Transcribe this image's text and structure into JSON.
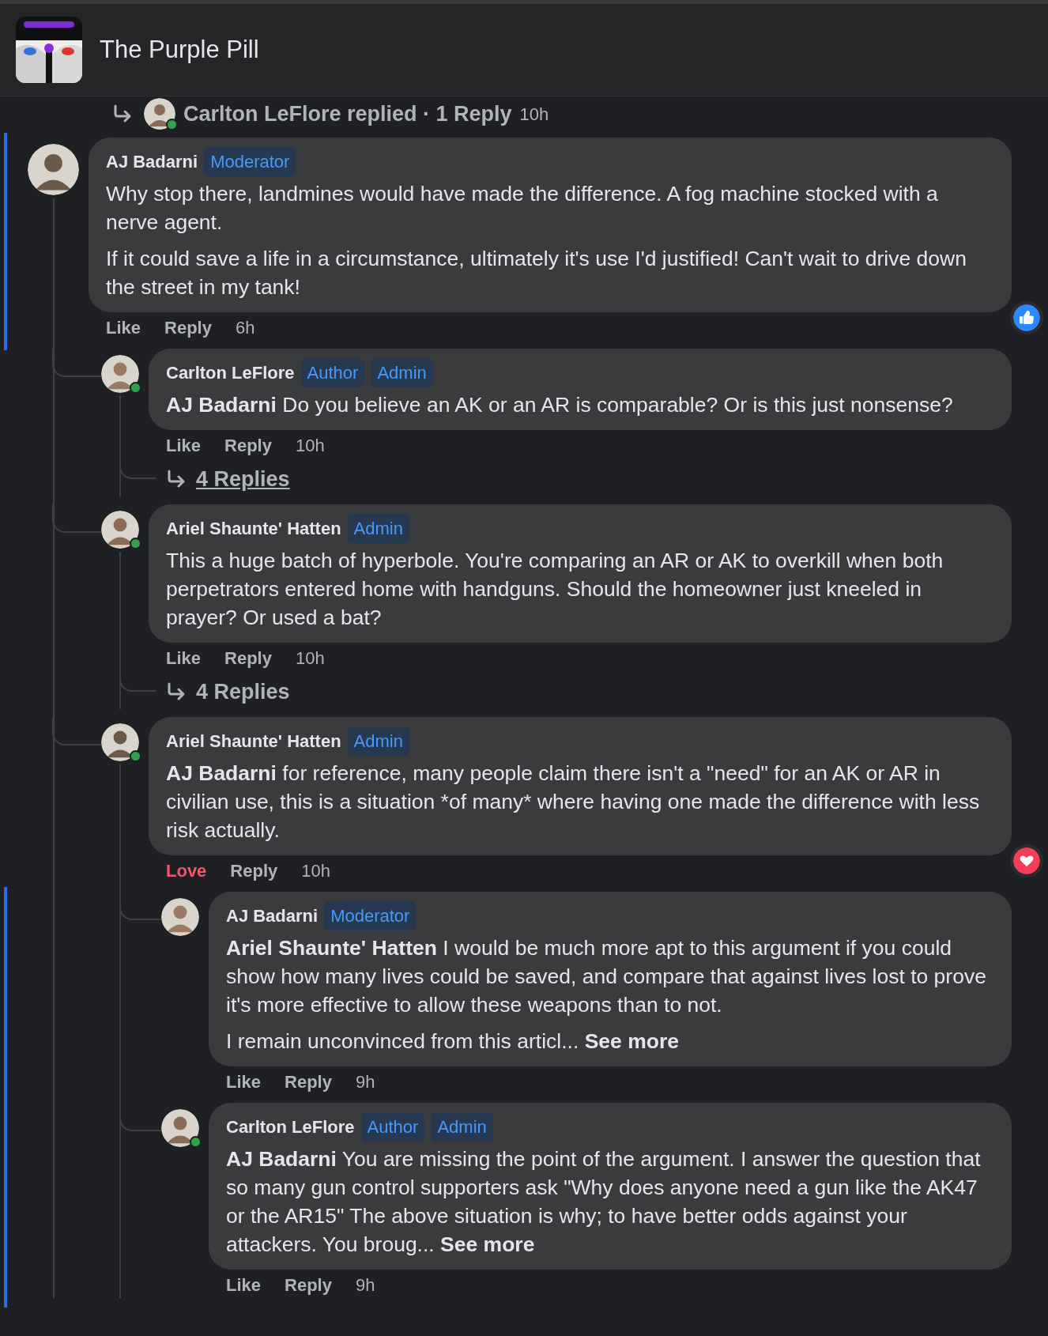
{
  "header": {
    "title": "The Purple Pill"
  },
  "collapsed_thread": {
    "text": "Carlton LeFlore replied · 1 Reply",
    "time": "10h",
    "online": true
  },
  "comments": [
    {
      "author": "AJ Badarni",
      "badges": [
        "Moderator"
      ],
      "online": false,
      "highlighted": true,
      "paragraphs": [
        {
          "text": "Why stop there, landmines would have made the difference. A fog machine stocked with a nerve agent."
        },
        {
          "text": "If it could save a life in a circumstance, ultimately it's use I'd justified! Can't wait to drive down the street in my tank!"
        }
      ],
      "react_label": "Like",
      "reply_label": "Reply",
      "time": "6h",
      "reaction": {
        "kind": "like"
      },
      "children": [
        {
          "author": "Carlton LeFlore",
          "badges": [
            "Author",
            "Admin"
          ],
          "online": true,
          "highlighted": false,
          "paragraphs": [
            {
              "mention": "AJ Badarni",
              "text": "Do you believe an AK or an AR is comparable? Or is this just nonsense?"
            }
          ],
          "react_label": "Like",
          "reply_label": "Reply",
          "time": "10h",
          "replies_link": {
            "text": "4 Replies",
            "underlined": true
          }
        },
        {
          "author": "Ariel Shaunte' Hatten",
          "badges": [
            "Admin"
          ],
          "online": true,
          "highlighted": false,
          "paragraphs": [
            {
              "text": "This a huge batch of hyperbole. You're comparing an AR or AK to overkill when both perpetrators entered home with handguns. Should the homeowner just kneeled in prayer? Or used a bat?"
            }
          ],
          "react_label": "Like",
          "reply_label": "Reply",
          "time": "10h",
          "replies_link": {
            "text": "4 Replies",
            "underlined": false
          }
        },
        {
          "author": "Ariel Shaunte' Hatten",
          "badges": [
            "Admin"
          ],
          "online": true,
          "highlighted": false,
          "paragraphs": [
            {
              "mention": "AJ Badarni",
              "text": "for reference, many people claim there isn't a \"need\" for an AK or AR in civilian use, this is a situation *of many* where having one made the difference with less risk actually."
            }
          ],
          "react_label": "Love",
          "reacted": true,
          "reply_label": "Reply",
          "time": "10h",
          "reaction": {
            "kind": "love"
          },
          "children": [
            {
              "author": "AJ Badarni",
              "badges": [
                "Moderator"
              ],
              "online": false,
              "highlighted": true,
              "paragraphs": [
                {
                  "mention": "Ariel Shaunte' Hatten",
                  "text": "I would be much more apt to this argument if you could show how many lives could be saved, and compare that against lives lost to prove it's more effective to allow these weapons than to not."
                },
                {
                  "text": "I remain unconvinced from this articl...",
                  "see_more": "See more"
                }
              ],
              "react_label": "Like",
              "reply_label": "Reply",
              "time": "9h"
            },
            {
              "author": "Carlton LeFlore",
              "badges": [
                "Author",
                "Admin"
              ],
              "online": true,
              "highlighted": true,
              "paragraphs": [
                {
                  "mention": "AJ Badarni",
                  "text": "You are missing the point of the argument. I answer the question that so many gun control supporters ask \"Why does anyone need a gun like the AK47 or the AR15\" The above situation is why; to have better odds against your attackers. You broug...",
                  "see_more": "See more"
                }
              ],
              "react_label": "Like",
              "reply_label": "Reply",
              "time": "9h"
            }
          ]
        }
      ]
    }
  ]
}
